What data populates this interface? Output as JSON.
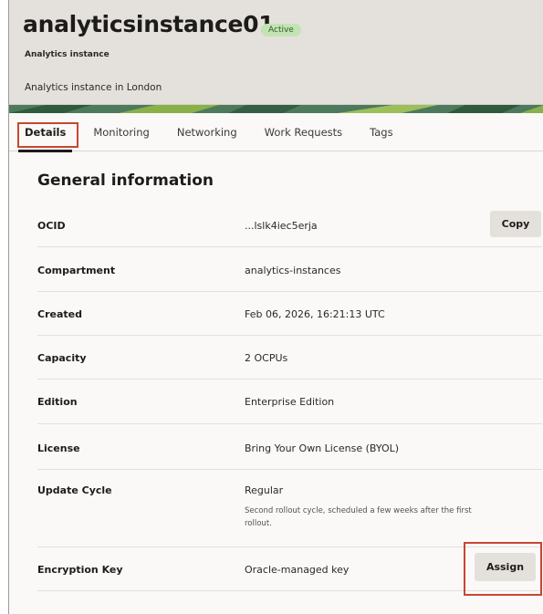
{
  "header": {
    "title": "analyticsinstance01",
    "status_badge": "Active",
    "subtitle": "Analytics instance",
    "description": "Analytics instance in London"
  },
  "tabs": [
    {
      "label": "Details",
      "active": true
    },
    {
      "label": "Monitoring",
      "active": false
    },
    {
      "label": "Networking",
      "active": false
    },
    {
      "label": "Work Requests",
      "active": false
    },
    {
      "label": "Tags",
      "active": false
    }
  ],
  "general": {
    "title": "General information",
    "ocid": {
      "label": "OCID",
      "value": "...lslk4iec5erja",
      "copy_label": "Copy"
    },
    "compartment": {
      "label": "Compartment",
      "value": "analytics-instances"
    },
    "created": {
      "label": "Created",
      "value": "Feb 06, 2026, 16:21:13 UTC"
    },
    "capacity": {
      "label": "Capacity",
      "value": "2 OCPUs"
    },
    "edition": {
      "label": "Edition",
      "value": "Enterprise Edition"
    },
    "license": {
      "label": "License",
      "value": "Bring Your Own License (BYOL)"
    },
    "update_cycle": {
      "label": "Update Cycle",
      "value": "Regular",
      "note": "Second rollout cycle, scheduled a few weeks after the first rollout."
    },
    "encryption_key": {
      "label": "Encryption Key",
      "value": "Oracle-managed key",
      "assign_label": "Assign"
    }
  },
  "colors": {
    "highlight": "#c74634",
    "active_badge_bg": "#c3e3b4",
    "header_bg": "#e4e1dc"
  }
}
